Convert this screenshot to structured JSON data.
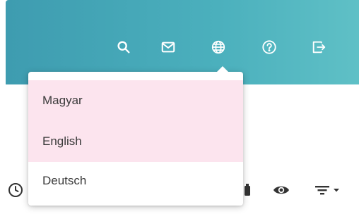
{
  "header": {
    "icons": [
      {
        "name": "search-icon"
      },
      {
        "name": "mail-icon"
      },
      {
        "name": "globe-icon"
      },
      {
        "name": "help-icon"
      },
      {
        "name": "logout-icon"
      }
    ],
    "background_color": "#4bb0bd"
  },
  "language_menu": {
    "items": [
      {
        "label": "Magyar",
        "highlighted": true
      },
      {
        "label": "English",
        "highlighted": true
      },
      {
        "label": "Deutsch",
        "highlighted": false
      }
    ],
    "highlight_color": "#fce4ee"
  },
  "toolbar": {
    "icons": [
      {
        "name": "clock-icon"
      },
      {
        "name": "camera-icon"
      },
      {
        "name": "eye-icon"
      },
      {
        "name": "filter-icon"
      }
    ]
  }
}
